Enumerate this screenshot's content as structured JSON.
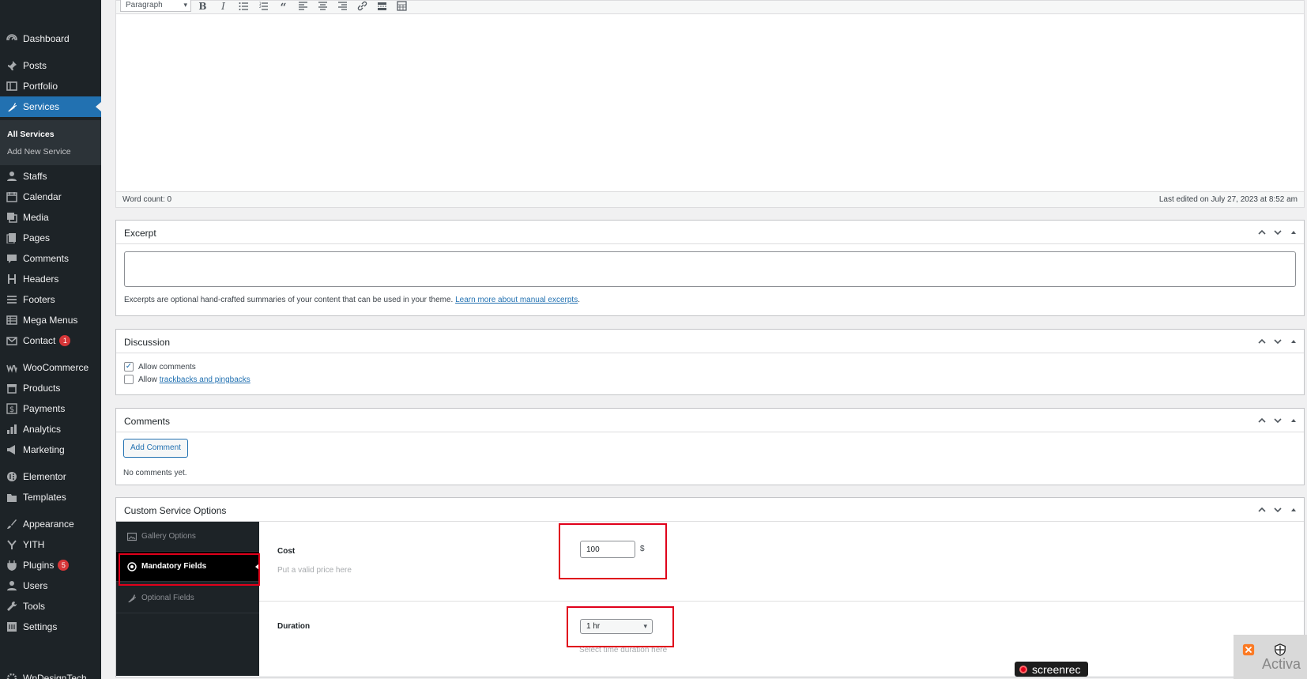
{
  "sidebar": {
    "items": [
      {
        "label": "Dashboard",
        "icon": "dashboard-icon"
      },
      {
        "label": "Posts",
        "icon": "pin-icon"
      },
      {
        "label": "Portfolio",
        "icon": "portfolio-icon"
      },
      {
        "label": "Services",
        "icon": "carrot-icon"
      },
      {
        "label": "Staffs",
        "icon": "user-icon"
      },
      {
        "label": "Calendar",
        "icon": "calendar-icon"
      },
      {
        "label": "Media",
        "icon": "media-icon"
      },
      {
        "label": "Pages",
        "icon": "pages-icon"
      },
      {
        "label": "Comments",
        "icon": "comment-icon"
      },
      {
        "label": "Headers",
        "icon": "heading-icon"
      },
      {
        "label": "Footers",
        "icon": "list-icon"
      },
      {
        "label": "Mega Menus",
        "icon": "table-icon"
      },
      {
        "label": "Contact",
        "icon": "mail-icon",
        "badge": "1"
      },
      {
        "label": "WooCommerce",
        "icon": "woo-icon"
      },
      {
        "label": "Products",
        "icon": "archive-icon"
      },
      {
        "label": "Payments",
        "icon": "dollar-icon"
      },
      {
        "label": "Analytics",
        "icon": "bar-chart-icon"
      },
      {
        "label": "Marketing",
        "icon": "megaphone-icon"
      },
      {
        "label": "Elementor",
        "icon": "elementor-icon"
      },
      {
        "label": "Templates",
        "icon": "folder-icon"
      },
      {
        "label": "Appearance",
        "icon": "brush-icon"
      },
      {
        "label": "YITH",
        "icon": "yith-icon"
      },
      {
        "label": "Plugins",
        "icon": "plug-icon",
        "badge": "5"
      },
      {
        "label": "Users",
        "icon": "users-icon"
      },
      {
        "label": "Tools",
        "icon": "wrench-icon"
      },
      {
        "label": "Settings",
        "icon": "settings-icon"
      },
      {
        "label": "WpDesignTech",
        "icon": "gear-icon"
      }
    ],
    "active": "Services",
    "submenu": [
      "All Services",
      "Add New Service"
    ],
    "colors": {
      "background": "#1d2327",
      "active": "#2271b1",
      "badge": "#d63638"
    }
  },
  "editor": {
    "format_select": "Paragraph",
    "toolbar_buttons": [
      "bold-icon",
      "italic-icon",
      "bullet-list-icon",
      "numbered-list-icon",
      "blockquote-icon",
      "align-left-icon",
      "align-center-icon",
      "align-right-icon",
      "link-icon",
      "read-more-icon",
      "toolbar-toggle-icon"
    ],
    "word_count": "Word count: 0",
    "last_edited": "Last edited on July 27, 2023 at 8:52 am"
  },
  "excerpt": {
    "title": "Excerpt",
    "help_text": "Excerpts are optional hand-crafted summaries of your content that can be used in your theme.",
    "help_link": "Learn more about manual excerpts",
    "help_end": "."
  },
  "discussion": {
    "title": "Discussion",
    "allow_comments": "Allow comments",
    "allow_comments_checked": true,
    "allow_prefix": "Allow",
    "trackbacks_link": "trackbacks and pingbacks",
    "trackbacks_checked": false
  },
  "comments": {
    "title": "Comments",
    "add_button": "Add Comment",
    "empty_text": "No comments yet."
  },
  "custom_options": {
    "title": "Custom Service Options",
    "tabs": [
      {
        "label": "Gallery Options",
        "icon": "image-icon"
      },
      {
        "label": "Mandatory Fields",
        "icon": "radio-icon"
      },
      {
        "label": "Optional Fields",
        "icon": "carrot-icon"
      }
    ],
    "active_tab": "Mandatory Fields",
    "cost": {
      "label": "Cost",
      "value": "100",
      "currency": "$",
      "help": "Put a valid price here"
    },
    "duration": {
      "label": "Duration",
      "value": "1 hr",
      "help": "Select time duration here"
    }
  },
  "overlays": {
    "screenrec": "screenrec",
    "activate": "Activa",
    "highlight_color": "#e0001b"
  }
}
